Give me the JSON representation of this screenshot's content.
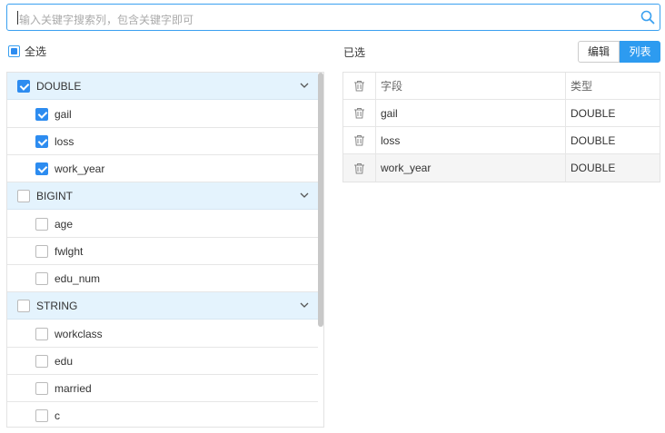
{
  "search": {
    "placeholder": "输入关键字搜索列，包含关键字即可"
  },
  "select_all": {
    "label": "全选"
  },
  "right": {
    "title": "已选",
    "edit_label": "编辑",
    "list_label": "列表"
  },
  "groups": [
    {
      "label": "DOUBLE",
      "checked": true,
      "items": [
        {
          "label": "gail",
          "checked": true
        },
        {
          "label": "loss",
          "checked": true
        },
        {
          "label": "work_year",
          "checked": true
        }
      ]
    },
    {
      "label": "BIGINT",
      "checked": false,
      "items": [
        {
          "label": "age",
          "checked": false
        },
        {
          "label": "fwlght",
          "checked": false
        },
        {
          "label": "edu_num",
          "checked": false
        }
      ]
    },
    {
      "label": "STRING",
      "checked": false,
      "items": [
        {
          "label": "workclass",
          "checked": false
        },
        {
          "label": "edu",
          "checked": false
        },
        {
          "label": "married",
          "checked": false
        },
        {
          "label": "c",
          "checked": false
        }
      ]
    }
  ],
  "table": {
    "headers": {
      "field": "字段",
      "type": "类型"
    },
    "rows": [
      {
        "field": "gail",
        "type": "DOUBLE"
      },
      {
        "field": "loss",
        "type": "DOUBLE"
      },
      {
        "field": "work_year",
        "type": "DOUBLE"
      }
    ]
  },
  "icons": {
    "search": "search-icon",
    "trash": "trash-icon",
    "chevron": "chevron-down-icon"
  },
  "colors": {
    "accent": "#2d8cf0",
    "group_bg": "#e4f3fd"
  }
}
